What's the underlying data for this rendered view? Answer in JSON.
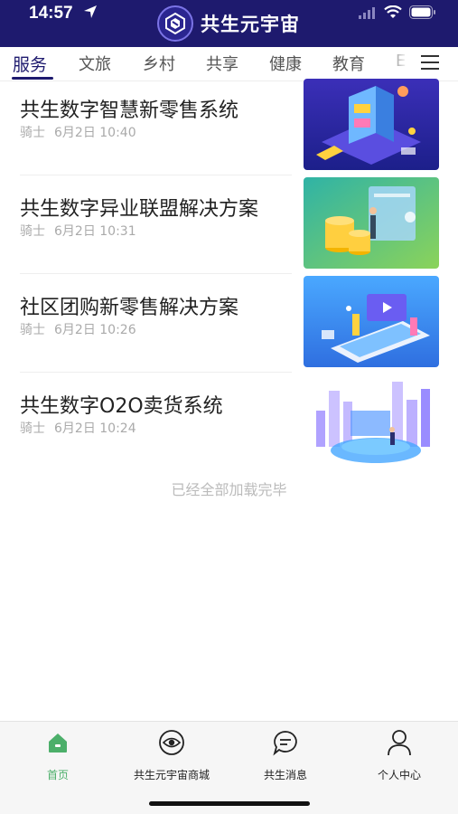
{
  "status": {
    "time": "14:57"
  },
  "app": {
    "title": "共生元宇宙"
  },
  "tabs": [
    {
      "label": "服务"
    },
    {
      "label": "文旅"
    },
    {
      "label": "乡村"
    },
    {
      "label": "共享"
    },
    {
      "label": "健康"
    },
    {
      "label": "教育"
    },
    {
      "label": "E"
    }
  ],
  "articles": [
    {
      "title": "共生数字智慧新零售系统",
      "author": "骑士",
      "date": "6月2日 10:40",
      "thumb_icon": "isometric-store-illustration"
    },
    {
      "title": "共生数字异业联盟解决方案",
      "author": "骑士",
      "date": "6月2日 10:31",
      "thumb_icon": "coins-business-illustration"
    },
    {
      "title": "社区团购新零售解决方案",
      "author": "骑士",
      "date": "6月2日 10:26",
      "thumb_icon": "mobile-video-illustration"
    },
    {
      "title": "共生数字O2O卖货系统",
      "author": "骑士",
      "date": "6月2日 10:24",
      "thumb_icon": "data-city-illustration"
    }
  ],
  "list_end_text": "已经全部加载完毕",
  "bottom_nav": [
    {
      "label": "首页",
      "icon": "home-icon",
      "active": true
    },
    {
      "label": "共生元宇宙商城",
      "icon": "eye-icon",
      "active": false
    },
    {
      "label": "共生消息",
      "icon": "chat-bubble-icon",
      "active": false
    },
    {
      "label": "个人中心",
      "icon": "person-icon",
      "active": false
    }
  ],
  "colors": {
    "header": "#1e1a6e",
    "active_nav": "#4caf6a",
    "meta_text": "#aaaaaa"
  }
}
